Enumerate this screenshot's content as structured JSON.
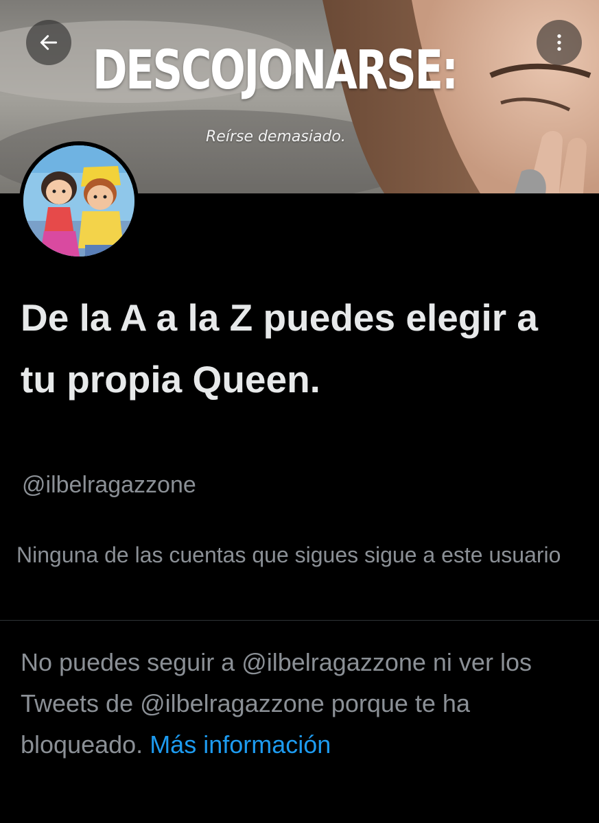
{
  "header": {
    "banner_title": "DESCOJONARSE:",
    "banner_subtitle": "Reírse demasiado.",
    "back_icon": "arrow-left-icon",
    "more_icon": "more-vertical-icon"
  },
  "profile": {
    "display_name": "De la A a la Z puedes elegir a tu propia Queen.",
    "handle": "@ilbelragazzone",
    "followers_note": "Ninguna de las cuentas que sigues sigue a este usuario"
  },
  "blocked": {
    "message": "No puedes seguir a @ilbelragazzone ni ver los Tweets de @ilbelragazzone porque te ha bloqueado.",
    "link_label": "Más información"
  },
  "colors": {
    "background": "#000000",
    "primary_text": "#e7e9ea",
    "secondary_text": "#8b9096",
    "link": "#1d9bf0"
  }
}
